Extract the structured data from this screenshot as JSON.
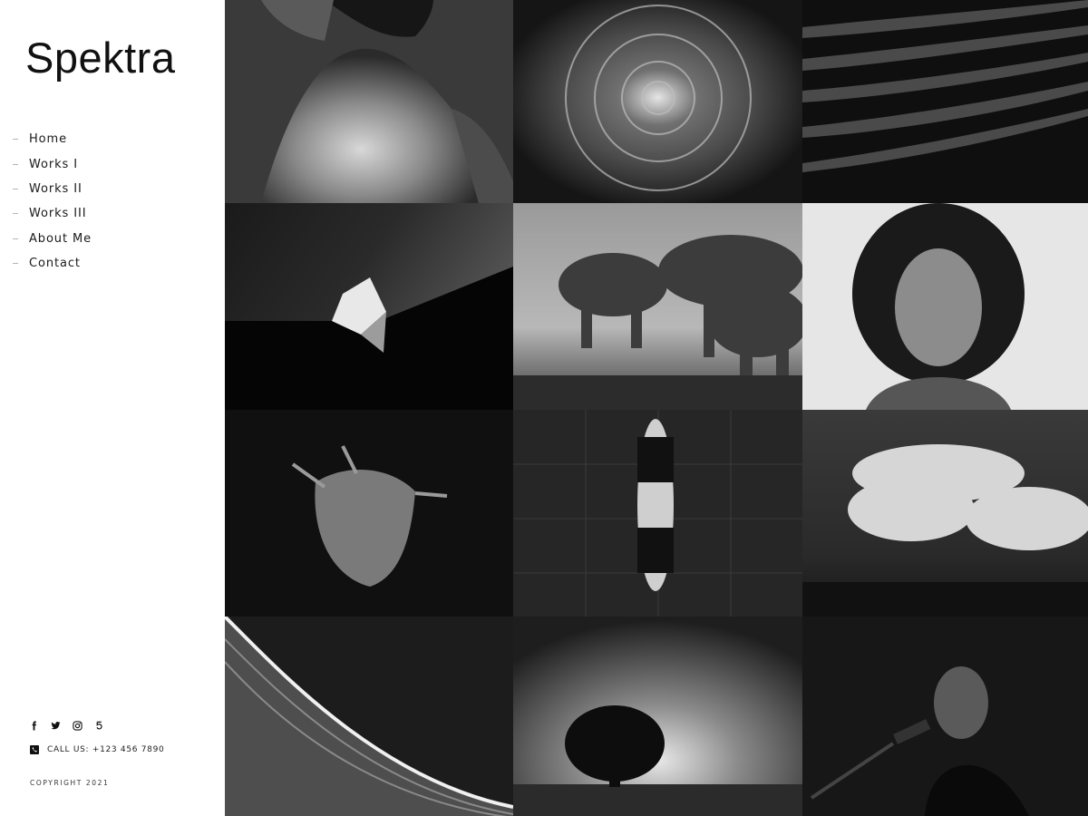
{
  "site": {
    "logo": "Spektra"
  },
  "nav": [
    {
      "label": "Home"
    },
    {
      "label": "Works I"
    },
    {
      "label": "Works II"
    },
    {
      "label": "Works III"
    },
    {
      "label": "About Me"
    },
    {
      "label": "Contact"
    }
  ],
  "social": [
    "facebook-icon",
    "twitter-icon",
    "instagram-icon",
    "500px-icon"
  ],
  "contact": {
    "call": "CALL US: +123 456 7890"
  },
  "footer": {
    "copyright": "COPYRIGHT 2021"
  },
  "gallery": [
    "woman-back",
    "chrysanthemum",
    "architecture-waves",
    "origami-structure",
    "elephants",
    "portrait-curly-hair",
    "wilted-flower",
    "underwater-swimmer",
    "clouds",
    "curved-building",
    "lone-tree",
    "singer-microphone"
  ]
}
